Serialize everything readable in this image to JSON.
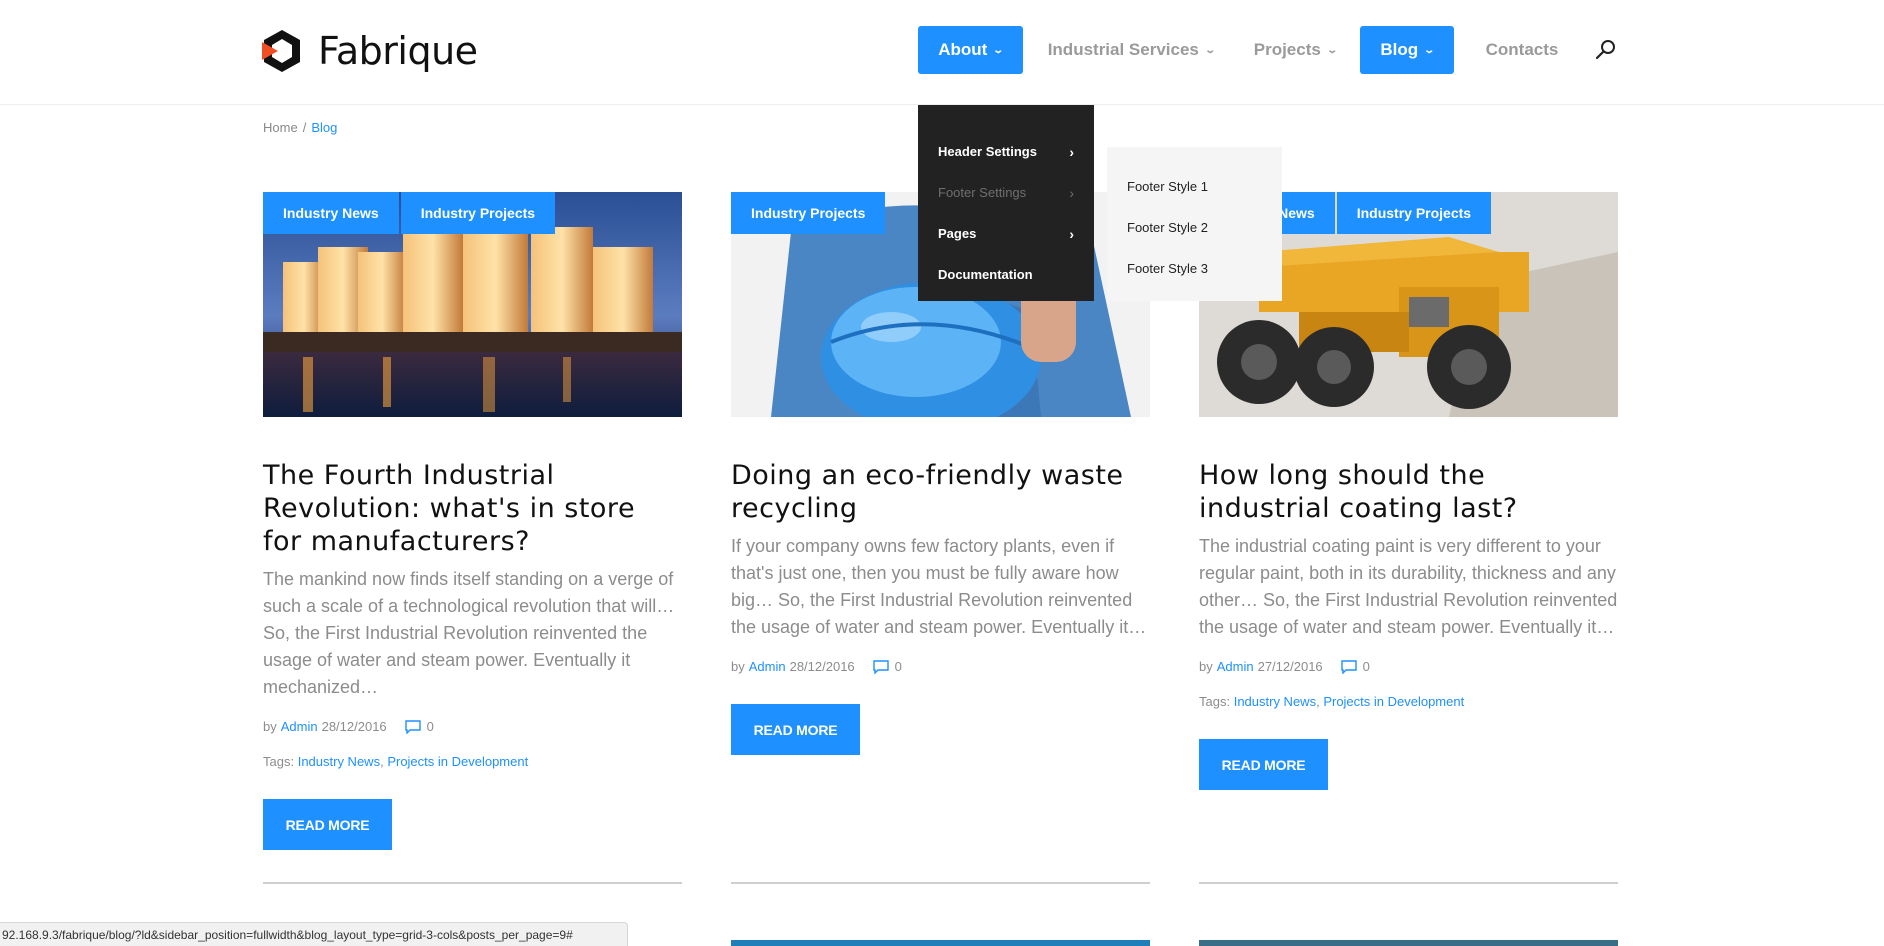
{
  "brand": {
    "name": "Fabrique"
  },
  "nav": {
    "items": [
      {
        "label": "About",
        "active": true,
        "has_dropdown": true
      },
      {
        "label": "Industrial Services",
        "active": false,
        "has_dropdown": true
      },
      {
        "label": "Projects",
        "active": false,
        "has_dropdown": true
      },
      {
        "label": "Blog",
        "active": true,
        "has_dropdown": true
      },
      {
        "label": "Contacts",
        "active": false,
        "has_dropdown": false
      }
    ],
    "search_icon": "search-icon"
  },
  "dropdown": {
    "items": [
      {
        "label": "Header Settings",
        "has_submenu": true
      },
      {
        "label": "Footer Settings",
        "has_submenu": true
      },
      {
        "label": "Pages",
        "has_submenu": true
      },
      {
        "label": "Documentation",
        "has_submenu": false
      }
    ],
    "submenu": [
      "Footer Style 1",
      "Footer Style 2",
      "Footer Style 3"
    ]
  },
  "breadcrumb": {
    "home": "Home",
    "separator": "/",
    "current": "Blog"
  },
  "posts": [
    {
      "categories": [
        "Industry News",
        "Industry Projects"
      ],
      "title": "The Fourth Industrial Revolution: what's in store for manufacturers?",
      "excerpt": "The mankind now finds itself standing on a verge of such a scale of a technological  revolution that will… So, the First Industrial Revolution reinvented the usage of water and steam power. Eventually it mechanized…",
      "by": "by",
      "author": "Admin",
      "date": "28/12/2016",
      "comments": "0",
      "tags_label": "Tags:",
      "tags": [
        "Industry News",
        "Projects in Development"
      ],
      "read_more": "READ MORE"
    },
    {
      "categories": [
        "Industry Projects"
      ],
      "title": "Doing an eco-friendly waste recycling",
      "excerpt": "If your company owns few factory plants, even if that's just one, then you must be fully aware how big… So, the First Industrial Revolution reinvented the usage of water and steam power. Eventually it…",
      "by": "by",
      "author": "Admin",
      "date": "28/12/2016",
      "comments": "0",
      "read_more": "READ MORE"
    },
    {
      "categories": [
        "Industry News",
        "Industry Projects"
      ],
      "title": "How long should the industrial coating last?",
      "excerpt": "The industrial coating paint is very different to your regular paint, both in its durability, thickness and any other…  So, the First Industrial Revolution reinvented the usage of water and steam power. Eventually it…",
      "by": "by",
      "author": "Admin",
      "date": "27/12/2016",
      "comments": "0",
      "tags_label": "Tags:",
      "tags": [
        "Industry News",
        "Projects in Development"
      ],
      "read_more": "READ MORE"
    }
  ],
  "status_bar": {
    "url": "92.168.9.3/fabrique/blog/?ld&sidebar_position=fullwidth&blog_layout_type=grid-3-cols&posts_per_page=9#"
  },
  "colors": {
    "accent": "#1e90ff",
    "dropdown_bg": "#222222",
    "submenu_bg": "#f5f5f5",
    "muted_text": "#8c8c8c"
  }
}
